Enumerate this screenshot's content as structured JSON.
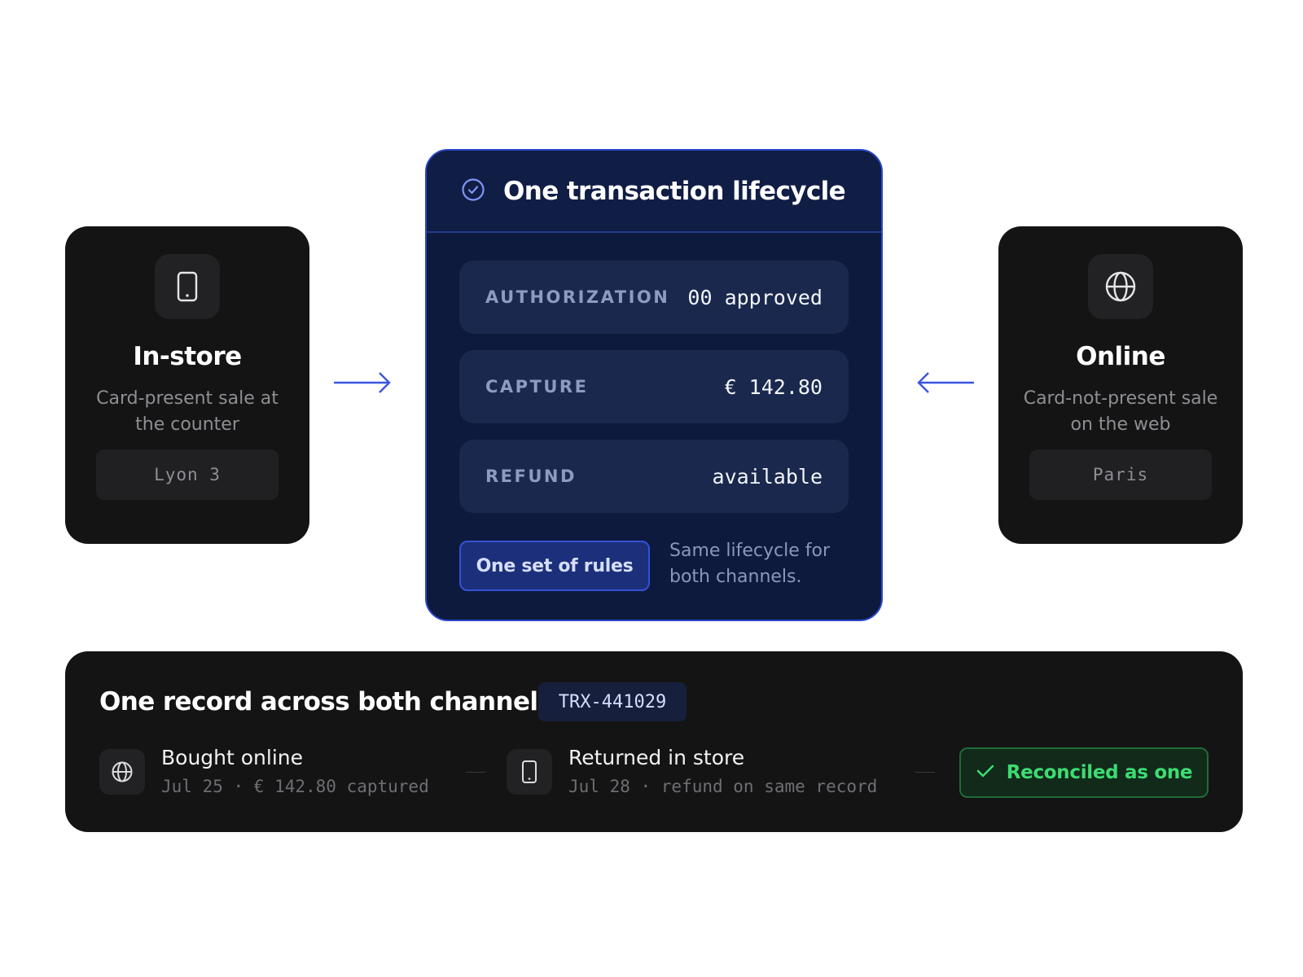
{
  "in_store": {
    "title": "In-store",
    "description": "Card-present sale at the counter",
    "location": "Lyon 3",
    "icon": "tablet-icon"
  },
  "online": {
    "title": "Online",
    "description": "Card-not-present sale on the web",
    "location": "Paris",
    "icon": "globe-icon"
  },
  "lifecycle": {
    "title": "One transaction lifecycle",
    "icon": "check-circle-icon",
    "steps": [
      {
        "label": "AUTHORIZATION",
        "value": "00 approved"
      },
      {
        "label": "CAPTURE",
        "value": "€ 142.80"
      },
      {
        "label": "REFUND",
        "value": "available"
      }
    ],
    "rules_label": "One set of rules",
    "rules_note": "Same lifecycle for both channels."
  },
  "record": {
    "title": "One record across both channels",
    "id": "TRX-441029",
    "events": [
      {
        "icon": "globe-icon",
        "title": "Bought online",
        "detail": "Jul 25 · € 142.80 captured"
      },
      {
        "icon": "tablet-icon",
        "title": "Returned in store",
        "detail": "Jul 28 · refund on same record"
      }
    ],
    "status": "Reconciled as one",
    "status_icon": "checkmark-icon"
  },
  "colors": {
    "accent_blue": "#3352d6",
    "success_green": "#3ddc72",
    "card_dark": "#141414",
    "lifecycle_navy": "#0e1a3d"
  }
}
